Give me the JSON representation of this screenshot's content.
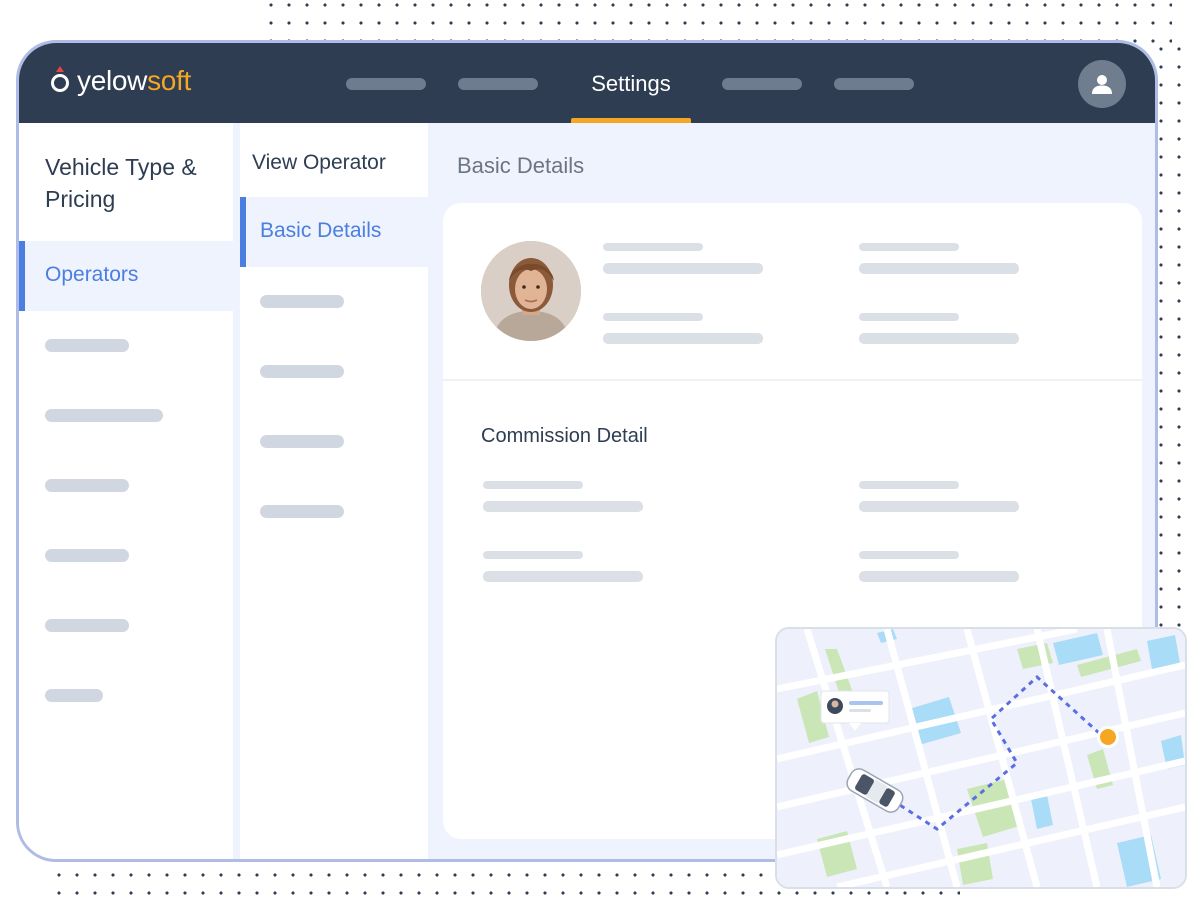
{
  "brand": {
    "name_part1": "yelow",
    "name_part2": "soft"
  },
  "header": {
    "active_nav_label": "Settings"
  },
  "sidebar1": {
    "title": "Vehicle Type & Pricing",
    "active_item": "Operators"
  },
  "sidebar2": {
    "title": "View Operator",
    "active_item": "Basic Details"
  },
  "main": {
    "title": "Basic Details",
    "commission_title": "Commission Detail"
  },
  "colors": {
    "header_bg": "#2e3d52",
    "accent": "#f5a623",
    "active_blue": "#4a7ee0",
    "route": "#5b6ee1"
  },
  "icons": [
    "user-icon",
    "logo-icon",
    "car-icon",
    "destination-pin-icon",
    "route-line"
  ]
}
